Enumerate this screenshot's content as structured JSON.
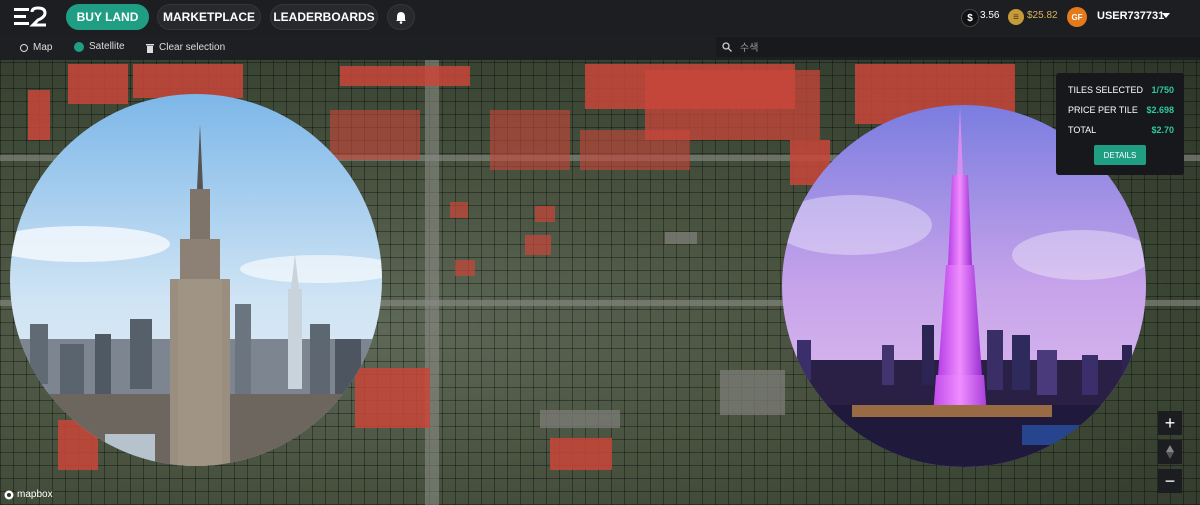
{
  "nav": {
    "buy_land": "BUY LAND",
    "marketplace": "MARKETPLACE",
    "leaderboards": "LEADERBOARDS"
  },
  "hud": {
    "dollar_value": "3.56",
    "essence_value": "$25.82",
    "avatar_initials": "GF",
    "username": "USER737731"
  },
  "toolbar": {
    "map_label": "Map",
    "satellite_label": "Satellite",
    "clear_label": "Clear selection",
    "search_placeholder": "수색"
  },
  "info": {
    "tiles_label": "TILES SELECTED",
    "tiles_value": "1/750",
    "price_label": "PRICE PER TILE",
    "price_value": "$2.698",
    "total_label": "TOTAL",
    "total_value": "$2.70",
    "details_label": "DETAILS"
  },
  "zoom": {
    "plus": "+",
    "minus": "−"
  },
  "attribution": "mapbox",
  "colors": {
    "accent": "#1f9e83",
    "panel": "#16181b",
    "bar": "#1c1e21"
  }
}
